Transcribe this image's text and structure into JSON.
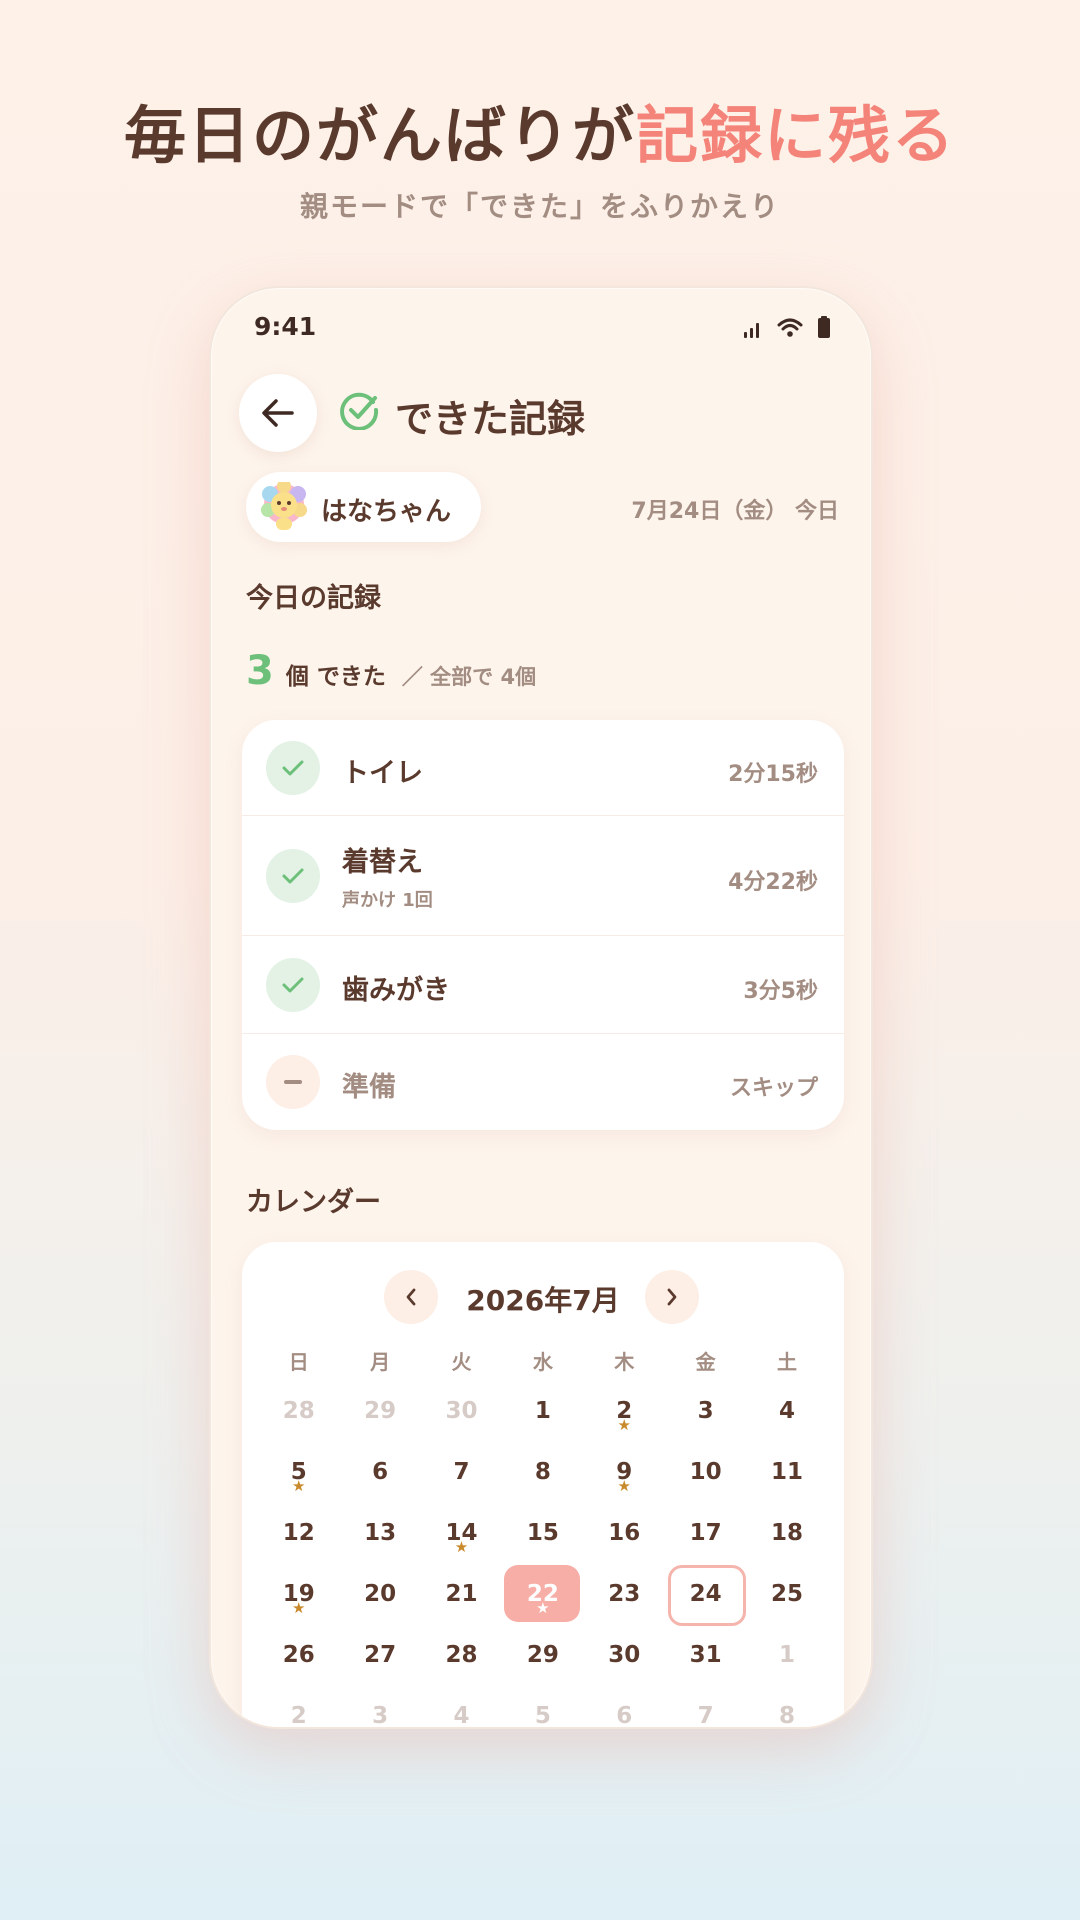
{
  "promo": {
    "headline_main": "毎日のがんばりが",
    "headline_accent": "記録に残る",
    "subline": "親モードで「できた」をふりかえり"
  },
  "status_bar": {
    "time": "9:41"
  },
  "header": {
    "title": "できた記録",
    "back_icon": "arrow-left-icon",
    "title_icon": "check-circle-icon"
  },
  "child": {
    "name": "はなちゃん",
    "avatar": "lion-avatar"
  },
  "date_label": "7月24日（金） 今日",
  "today_section": {
    "title": "今日の記録",
    "count": "3",
    "count_unit": "個 できた",
    "count_total": "／ 全部で 4個"
  },
  "tasks": [
    {
      "name": "トイレ",
      "sub": "",
      "time": "2分15秒",
      "status": "done"
    },
    {
      "name": "着替え",
      "sub": "声かけ 1回",
      "time": "4分22秒",
      "status": "done"
    },
    {
      "name": "歯みがき",
      "sub": "",
      "time": "3分5秒",
      "status": "done"
    },
    {
      "name": "準備",
      "sub": "",
      "time": "スキップ",
      "status": "skipped"
    }
  ],
  "calendar": {
    "section_title": "カレンダー",
    "month_label": "2026年7月",
    "weekdays": [
      "日",
      "月",
      "火",
      "水",
      "木",
      "金",
      "土"
    ],
    "weeks": [
      [
        {
          "d": "28",
          "m": true
        },
        {
          "d": "29",
          "m": true
        },
        {
          "d": "30",
          "m": true
        },
        {
          "d": "1"
        },
        {
          "d": "2",
          "star": true
        },
        {
          "d": "3"
        },
        {
          "d": "4"
        }
      ],
      [
        {
          "d": "5",
          "star": true
        },
        {
          "d": "6"
        },
        {
          "d": "7"
        },
        {
          "d": "8"
        },
        {
          "d": "9",
          "star": true
        },
        {
          "d": "10"
        },
        {
          "d": "11"
        }
      ],
      [
        {
          "d": "12"
        },
        {
          "d": "13"
        },
        {
          "d": "14",
          "star": true
        },
        {
          "d": "15"
        },
        {
          "d": "16"
        },
        {
          "d": "17"
        },
        {
          "d": "18"
        }
      ],
      [
        {
          "d": "19",
          "star": true
        },
        {
          "d": "20"
        },
        {
          "d": "21"
        },
        {
          "d": "22",
          "star": true,
          "selected": true
        },
        {
          "d": "23"
        },
        {
          "d": "24",
          "today": true
        },
        {
          "d": "25"
        }
      ],
      [
        {
          "d": "26"
        },
        {
          "d": "27"
        },
        {
          "d": "28"
        },
        {
          "d": "29"
        },
        {
          "d": "30"
        },
        {
          "d": "31"
        },
        {
          "d": "1",
          "m": true
        }
      ],
      [
        {
          "d": "2",
          "m": true
        },
        {
          "d": "3",
          "m": true
        },
        {
          "d": "4",
          "m": true
        },
        {
          "d": "5",
          "m": true
        },
        {
          "d": "6",
          "m": true
        },
        {
          "d": "7",
          "m": true
        },
        {
          "d": "8",
          "m": true
        }
      ]
    ]
  },
  "colors": {
    "accent": "#f4847a",
    "success": "#6cc07a",
    "text": "#5b3a2e",
    "muted": "#a38d82",
    "star": "#c98a2c"
  }
}
